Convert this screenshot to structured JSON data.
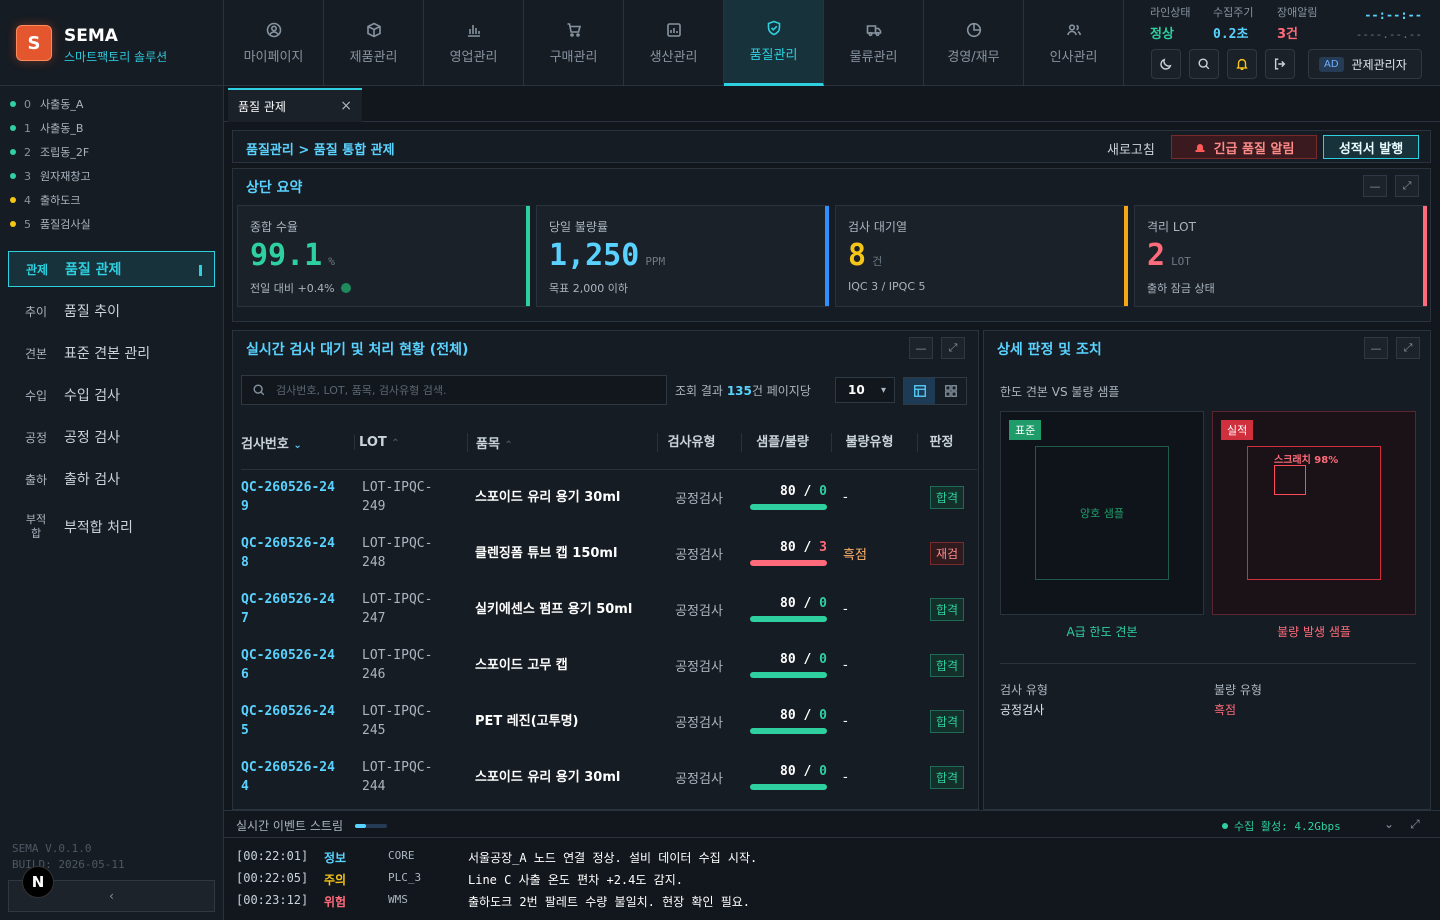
{
  "brand": {
    "logo_letter": "S",
    "name": "SEMA",
    "tagline": "스마트팩토리 솔루션"
  },
  "nav": [
    {
      "label": "마이페이지",
      "icon": "user-circle-icon"
    },
    {
      "label": "제품관리",
      "icon": "box-icon"
    },
    {
      "label": "영업관리",
      "icon": "bar-chart-icon"
    },
    {
      "label": "구매관리",
      "icon": "cart-icon"
    },
    {
      "label": "생산관리",
      "icon": "factory-icon"
    },
    {
      "label": "품질관리",
      "icon": "shield-check-icon",
      "active": true
    },
    {
      "label": "물류관리",
      "icon": "truck-icon"
    },
    {
      "label": "경영/재무",
      "icon": "pie-chart-icon"
    },
    {
      "label": "인사관리",
      "icon": "users-icon"
    }
  ],
  "status": {
    "line_label": "라인상태",
    "line_value": "정상",
    "cycle_label": "수집주기",
    "cycle_value": "0.2초",
    "fault_label": "장애알림",
    "fault_value": "3건",
    "clock_top": "--:--:--",
    "clock_bottom": "----.--.--",
    "user_badge": "AD",
    "user_name": "관제관리자"
  },
  "lines": [
    {
      "idx": "0",
      "name": "사출동_A",
      "color": "#2ed0a0"
    },
    {
      "idx": "1",
      "name": "사출동_B",
      "color": "#2ed0a0"
    },
    {
      "idx": "2",
      "name": "조립동_2F",
      "color": "#2ed0a0"
    },
    {
      "idx": "3",
      "name": "원자재창고",
      "color": "#2ed0a0"
    },
    {
      "idx": "4",
      "name": "출하도크",
      "color": "#f5c518"
    },
    {
      "idx": "5",
      "name": "품질검사실",
      "color": "#f5c518"
    }
  ],
  "menu": [
    {
      "abbr": "관제",
      "label": "품질 관제",
      "active": true
    },
    {
      "abbr": "추이",
      "label": "품질 추이"
    },
    {
      "abbr": "견본",
      "label": "표준 견본 관리"
    },
    {
      "abbr": "수입",
      "label": "수입 검사"
    },
    {
      "abbr": "공정",
      "label": "공정 검사"
    },
    {
      "abbr": "출하",
      "label": "출하 검사"
    },
    {
      "abbr": "부적합",
      "label": "부적합 처리"
    }
  ],
  "version": {
    "line1": "SEMA V.0.1.0",
    "line2": "BUILD: 2026-05-11",
    "collapse": "‹",
    "n_badge": "N"
  },
  "tab": {
    "label": "품질 관제",
    "close": "×"
  },
  "crumb": {
    "path": "품질관리 > 품질 통합 관제",
    "refresh": "새로고침",
    "alert": "긴급 품질 알림",
    "report": "성적서 발행"
  },
  "summary": {
    "title": "상단 요약",
    "kpis": [
      {
        "label": "종합 수율",
        "value": "99.1",
        "unit": "%",
        "note": "전일 대비 +0.4%",
        "color": "#2ed0a0"
      },
      {
        "label": "당일 불량률",
        "value": "1,250",
        "unit": "PPM",
        "note": "목표 2,000 이하",
        "color": "#5ad2ff"
      },
      {
        "label": "검사 대기열",
        "value": "8",
        "unit": "건",
        "note": "IQC 3 / IPQC 5",
        "color": "#f5c518"
      },
      {
        "label": "격리 LOT",
        "value": "2",
        "unit": "LOT",
        "note": "출하 잠금 상태",
        "color": "#ff6b7a"
      }
    ]
  },
  "inspection": {
    "title": "실시간 검사 대기 및 처리 현황 (전체)",
    "search_placeholder": "검사번호, LOT, 품목, 검사유형 검색.",
    "result_prefix": "조회 결과",
    "result_count": "135",
    "result_suffix": "건 페이지당",
    "page_size": "10",
    "columns": [
      "검사번호",
      "LOT",
      "품목",
      "검사유형",
      "샘플/불량",
      "불량유형",
      "판정"
    ],
    "rows": [
      {
        "id": "QC-260526-249",
        "lot": "LOT-IPQC-249",
        "name": "스포이드 유리 용기 30ml",
        "type": "공정검사",
        "sample": "80",
        "bad": "0",
        "ratio": 1.0,
        "defect": "-",
        "verdict": "합격",
        "v": "ok"
      },
      {
        "id": "QC-260526-248",
        "lot": "LOT-IPQC-248",
        "name": "클렌징폼 튜브 캡 150ml",
        "type": "공정검사",
        "sample": "80",
        "bad": "3",
        "ratio": 1.0,
        "defect": "흑점",
        "verdict": "재검",
        "v": "re"
      },
      {
        "id": "QC-260526-247",
        "lot": "LOT-IPQC-247",
        "name": "실키에센스 펌프 용기 50ml",
        "type": "공정검사",
        "sample": "80",
        "bad": "0",
        "ratio": 1.0,
        "defect": "-",
        "verdict": "합격",
        "v": "ok"
      },
      {
        "id": "QC-260526-246",
        "lot": "LOT-IPQC-246",
        "name": "스포이드 고무 캡",
        "type": "공정검사",
        "sample": "80",
        "bad": "0",
        "ratio": 1.0,
        "defect": "-",
        "verdict": "합격",
        "v": "ok"
      },
      {
        "id": "QC-260526-245",
        "lot": "LOT-IPQC-245",
        "name": "PET 레진(고투명)",
        "type": "공정검사",
        "sample": "80",
        "bad": "0",
        "ratio": 1.0,
        "defect": "-",
        "verdict": "합격",
        "v": "ok"
      },
      {
        "id": "QC-260526-244",
        "lot": "LOT-IPQC-244",
        "name": "스포이드 유리 용기 30ml",
        "type": "공정검사",
        "sample": "80",
        "bad": "0",
        "ratio": 1.0,
        "defect": "-",
        "verdict": "합격",
        "v": "ok"
      }
    ]
  },
  "detail": {
    "title": "상세 판정 및 조치",
    "subtitle": "한도 견본 VS 불량 샘플",
    "std_tag": "표준",
    "std_inner": "양호 샘플",
    "std_caption": "A급 한도 견본",
    "act_tag": "실적",
    "act_inner": "스크래치 98%",
    "act_caption": "불량 발생 샘플",
    "insp_type_label": "검사 유형",
    "insp_type_value": "공정검사",
    "defect_label": "불량 유형",
    "defect_value": "흑점"
  },
  "events": {
    "title": "실시간 이벤트 스트림",
    "status": "수집 활성: 4.2Gbps",
    "rows": [
      {
        "time": "[00:22:01]",
        "level": "정보",
        "color": "#5ad2ff",
        "src": "CORE",
        "msg": "서울공장_A 노드 연결 정상. 설비 데이터 수집 시작."
      },
      {
        "time": "[00:22:05]",
        "level": "주의",
        "color": "#f5c518",
        "src": "PLC_3",
        "msg": "Line C 사출 온도 편차 +2.4도 감지."
      },
      {
        "time": "[00:23:12]",
        "level": "위험",
        "color": "#ff6b7a",
        "src": "WMS",
        "msg": "출하도크 2번 팔레트 수량 불일치. 현장 확인 필요."
      }
    ]
  }
}
